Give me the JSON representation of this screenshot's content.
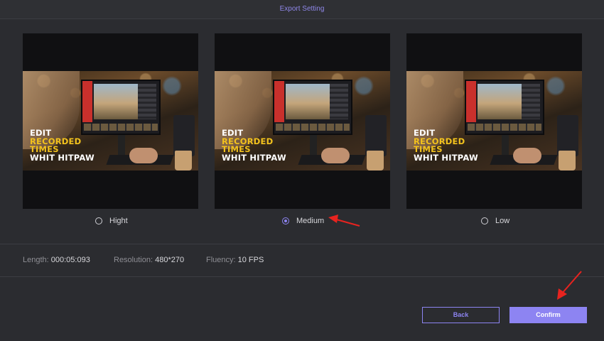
{
  "window": {
    "title": "Export Setting"
  },
  "previews": [
    {
      "id": "hight",
      "overlay": [
        "EDIT",
        "RECORDED",
        "TIMES",
        "WHIT HITPAW"
      ]
    },
    {
      "id": "medium",
      "overlay": [
        "EDIT",
        "RECORDED",
        "TIMES",
        "WHIT HITPAW"
      ]
    },
    {
      "id": "low",
      "overlay": [
        "EDIT",
        "RECORDED",
        "TIMES",
        "WHIT HITPAW"
      ]
    }
  ],
  "quality_options": [
    {
      "label": "Hight",
      "selected": false
    },
    {
      "label": "Medium",
      "selected": true
    },
    {
      "label": "Low",
      "selected": false
    }
  ],
  "info": {
    "length_label": "Length:",
    "length_value": "000:05:093",
    "resolution_label": "Resolution:",
    "resolution_value": "480*270",
    "fluency_label": "Fluency:",
    "fluency_value": "10 FPS"
  },
  "buttons": {
    "back": "Back",
    "confirm": "Confirm"
  },
  "colors": {
    "accent": "#8d84f2",
    "annotation": "#e8231f",
    "background": "#2b2c30"
  }
}
